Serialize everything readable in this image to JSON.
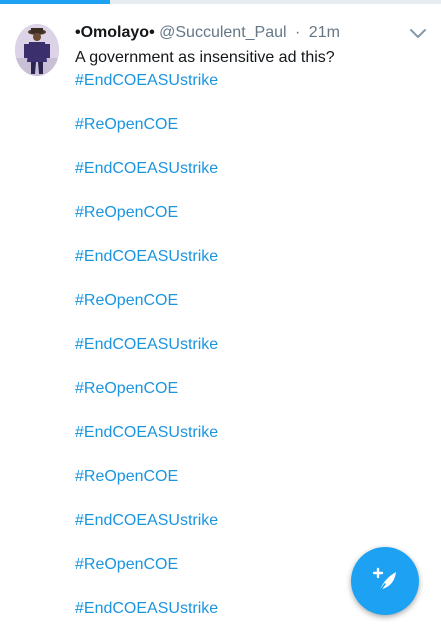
{
  "tweet": {
    "display_name": "•Omolayo•",
    "handle": "@Succulent_Paul",
    "separator": "·",
    "time": "21m",
    "text": "A government as insensitive ad this?",
    "hashtags": [
      "#EndCOEASUstrike",
      "#ReOpenCOE",
      "#EndCOEASUstrike",
      "#ReOpenCOE",
      "#EndCOEASUstrike",
      "#ReOpenCOE",
      "#EndCOEASUstrike",
      "#ReOpenCOE",
      "#EndCOEASUstrike",
      "#ReOpenCOE",
      "#EndCOEASUstrike",
      "#ReOpenCOE",
      "#EndCOEASUstrike"
    ]
  },
  "icons": {
    "caret": "chevron-down-icon",
    "compose": "compose-tweet-icon"
  },
  "colors": {
    "accent": "#1da1f2",
    "hashtag": "#1b95e0",
    "text": "#14171a",
    "secondary": "#657786"
  },
  "progress": {
    "fraction": 0.25
  }
}
